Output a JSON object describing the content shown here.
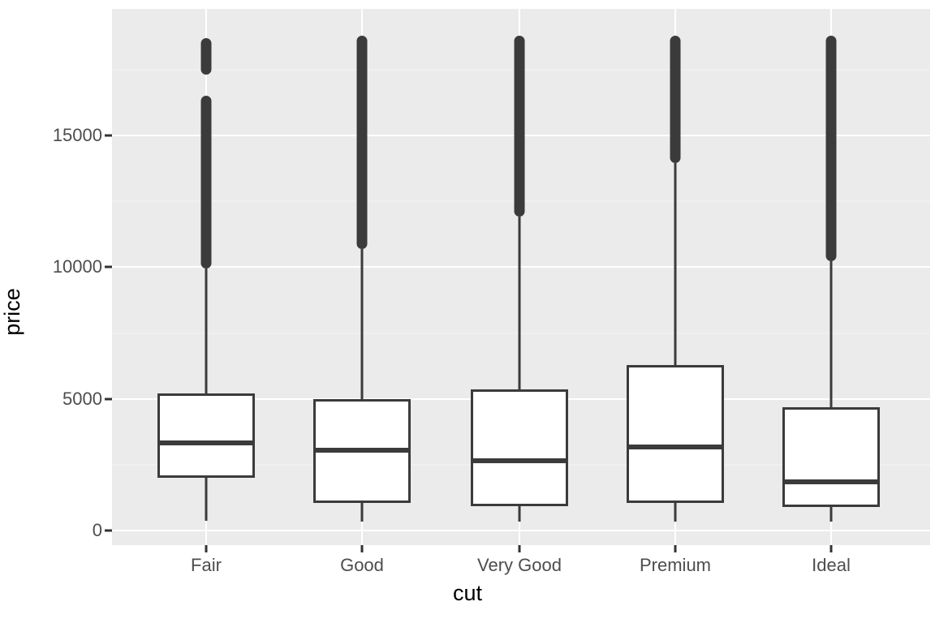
{
  "chart_data": {
    "type": "box",
    "title": "",
    "xlabel": "cut",
    "ylabel": "price",
    "categories": [
      "Fair",
      "Good",
      "Very Good",
      "Premium",
      "Ideal"
    ],
    "y_ticks": [
      0,
      5000,
      10000,
      15000
    ],
    "y_tick_labels": [
      "0",
      "5000",
      "10000",
      "15000"
    ],
    "ylim": [
      -420,
      19900
    ],
    "grid": "major and minor horizontal, major vertical (white on grey panel)",
    "legend": "none",
    "theme": {
      "panel_background": "#ebebeb",
      "major_grid_color": "#ffffff",
      "minor_grid_color": "#f5f5f5",
      "box_line_color": "#3b3b3b",
      "box_fill": "#ffffff",
      "axis_text_color": "#4d4d4d",
      "axis_title_color": "#000000",
      "plot_background": "#ffffff"
    },
    "boxes": [
      {
        "category": "Fair",
        "lower_whisker": 360,
        "q1": 2000,
        "median": 3325,
        "q3": 5200,
        "upper_whisker": 9950,
        "outlier_min": 9960,
        "outlier_max": 18700,
        "outlier_gap": [
          16500,
          17300
        ]
      },
      {
        "category": "Good",
        "lower_whisker": 335,
        "q1": 1050,
        "median": 3050,
        "q3": 5000,
        "upper_whisker": 10680,
        "outlier_min": 10680,
        "outlier_max": 18780,
        "outlier_gap": null
      },
      {
        "category": "Very Good",
        "lower_whisker": 336,
        "q1": 920,
        "median": 2650,
        "q3": 5360,
        "upper_whisker": 11920,
        "outlier_min": 11920,
        "outlier_max": 18800,
        "outlier_gap": null
      },
      {
        "category": "Premium",
        "lower_whisker": 326,
        "q1": 1050,
        "median": 3170,
        "q3": 6280,
        "upper_whisker": 13950,
        "outlier_min": 13950,
        "outlier_max": 18800,
        "outlier_gap": null
      },
      {
        "category": "Ideal",
        "lower_whisker": 350,
        "q1": 880,
        "median": 1850,
        "q3": 4680,
        "upper_whisker": 10230,
        "outlier_min": 10230,
        "outlier_max": 18800,
        "outlier_gap": null
      }
    ]
  },
  "axes": {
    "y_title": "price",
    "x_title": "cut"
  }
}
